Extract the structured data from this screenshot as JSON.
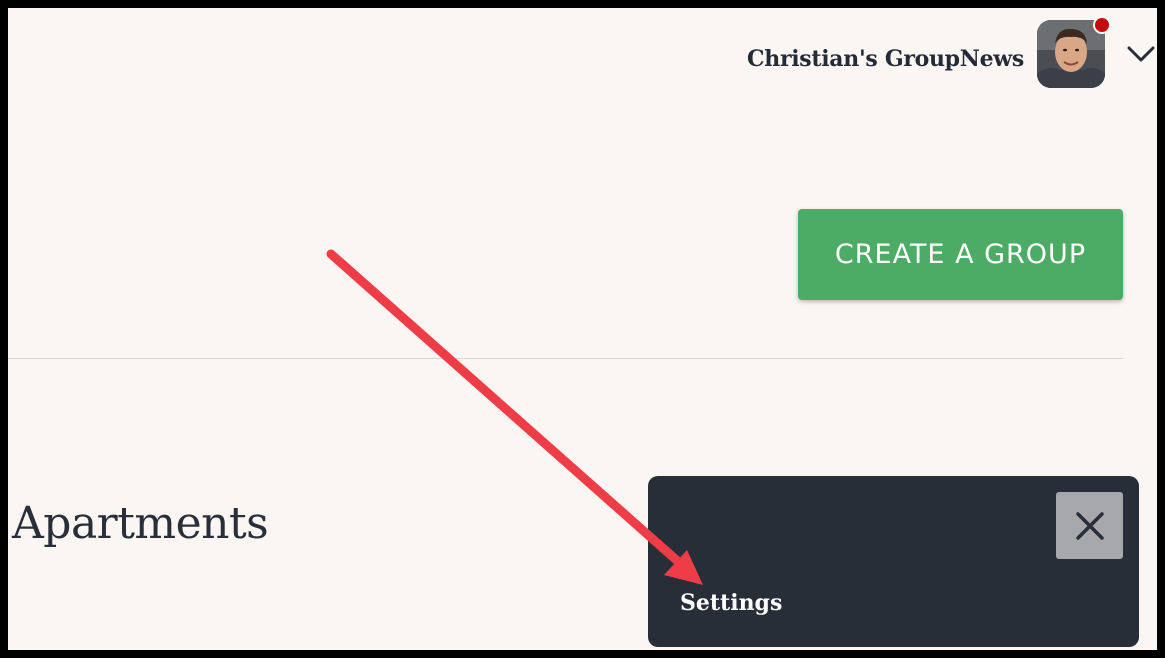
{
  "header": {
    "title": "Christian's GroupNews",
    "avatar_icon": "user-avatar",
    "menu_icon": "chevron-down-icon",
    "notification_color": "#c40c0c"
  },
  "main": {
    "create_button_label": "CREATE A GROUP",
    "create_button_color": "#4cab64",
    "section_heading": "Apartments"
  },
  "toast": {
    "label": "Settings",
    "close_icon": "close-icon",
    "background": "#272e38"
  },
  "annotation": {
    "arrow_color": "#ef3d48"
  }
}
